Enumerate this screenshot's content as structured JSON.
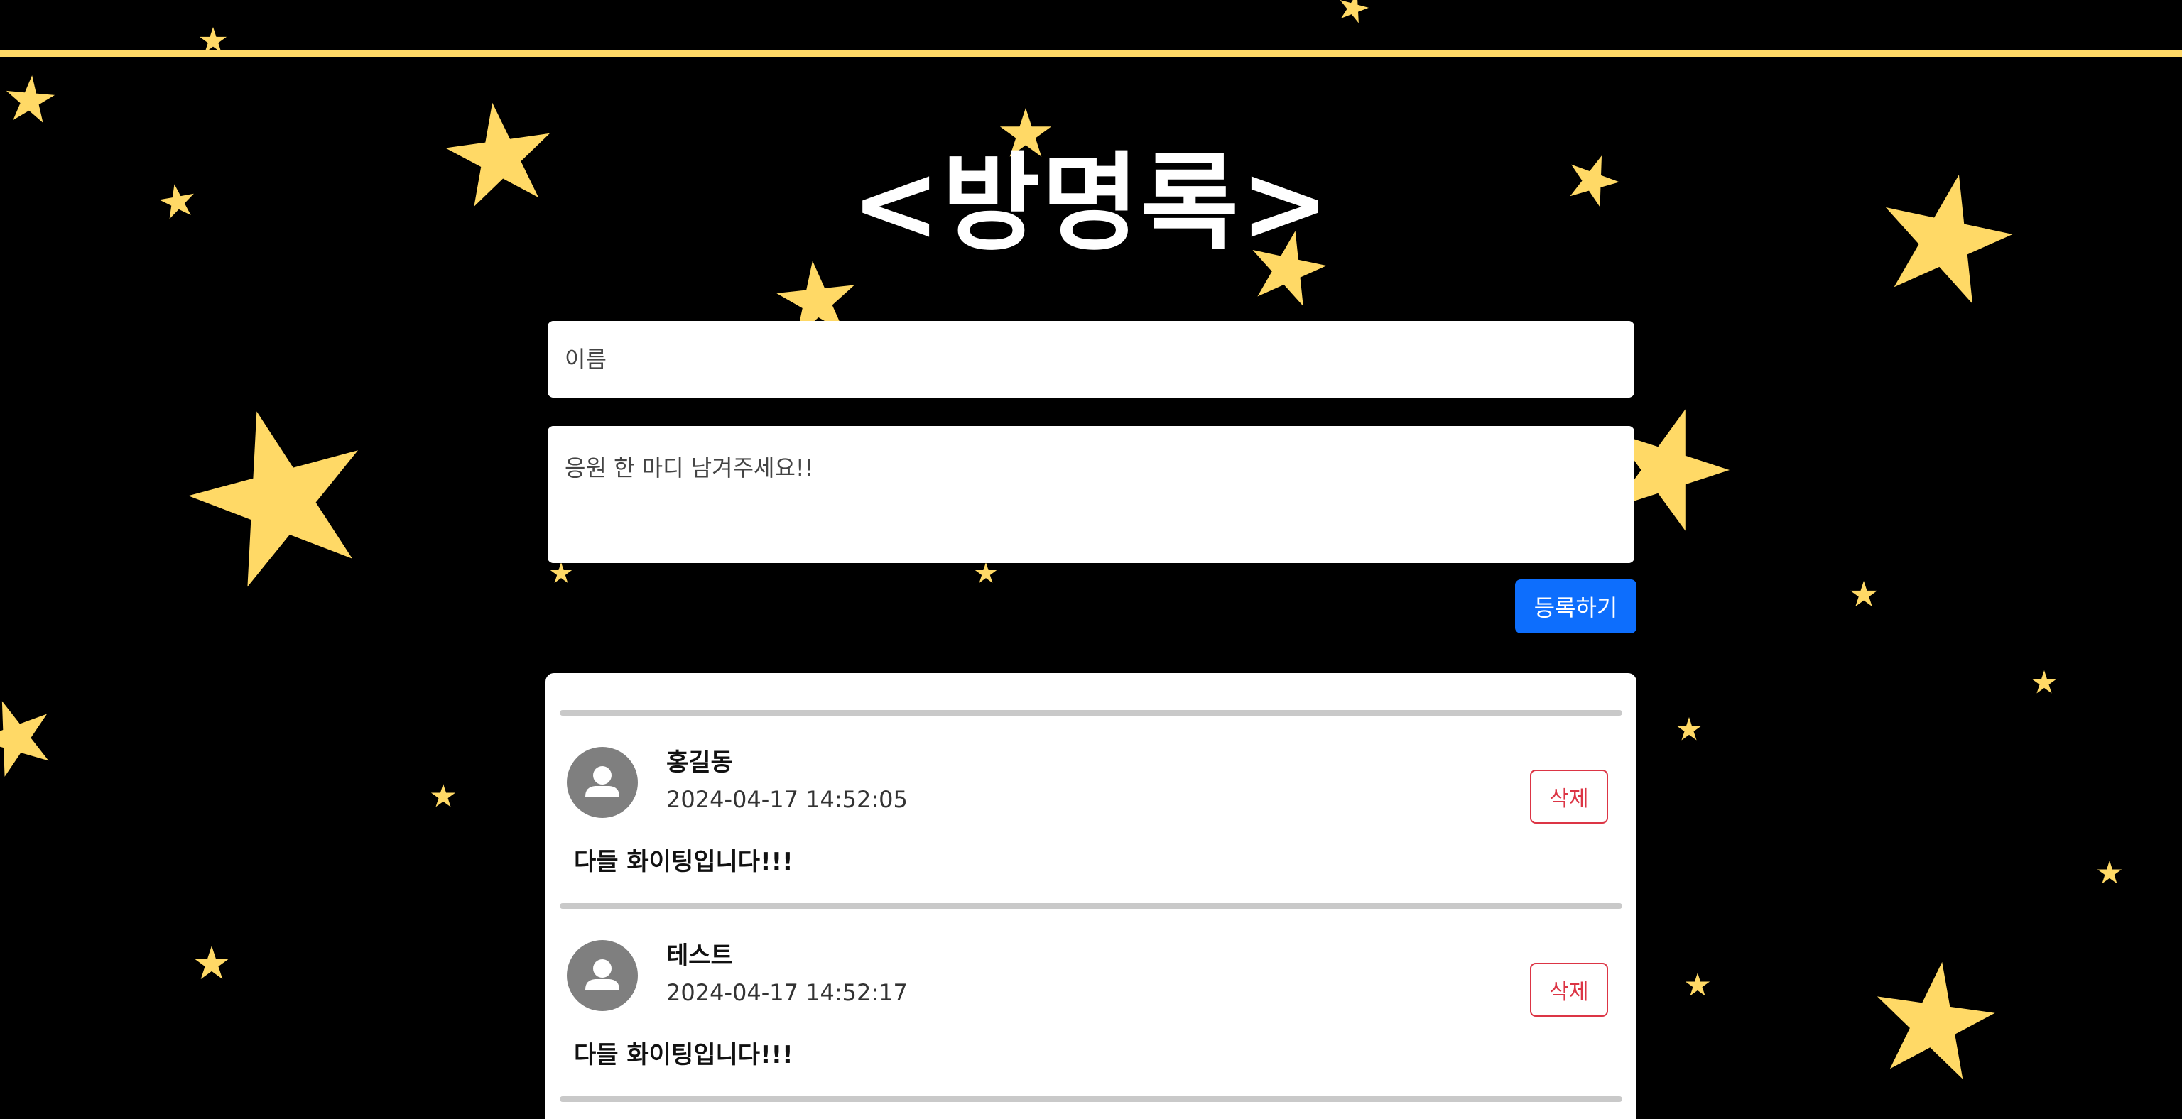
{
  "header": {
    "title": "<방명록>"
  },
  "form": {
    "name_placeholder": "이름",
    "message_placeholder": "응원 한 마디 남겨주세요!!",
    "submit_label": "등록하기"
  },
  "entries": [
    {
      "name": "홍길동",
      "date": "2024-04-17 14:52:05",
      "message": "다들 화이팅입니다!!!",
      "delete_label": "삭제"
    },
    {
      "name": "테스트",
      "date": "2024-04-17 14:52:17",
      "message": "다들 화이팅입니다!!!",
      "delete_label": "삭제"
    }
  ],
  "colors": {
    "background": "#000000",
    "star": "#ffd966",
    "accent_line": "#ffd966",
    "submit_button": "#0d6efd",
    "delete_button": "#dc3545",
    "avatar": "#7f7f7f"
  },
  "icons": {
    "star": "star-icon",
    "avatar": "user-avatar-icon"
  }
}
